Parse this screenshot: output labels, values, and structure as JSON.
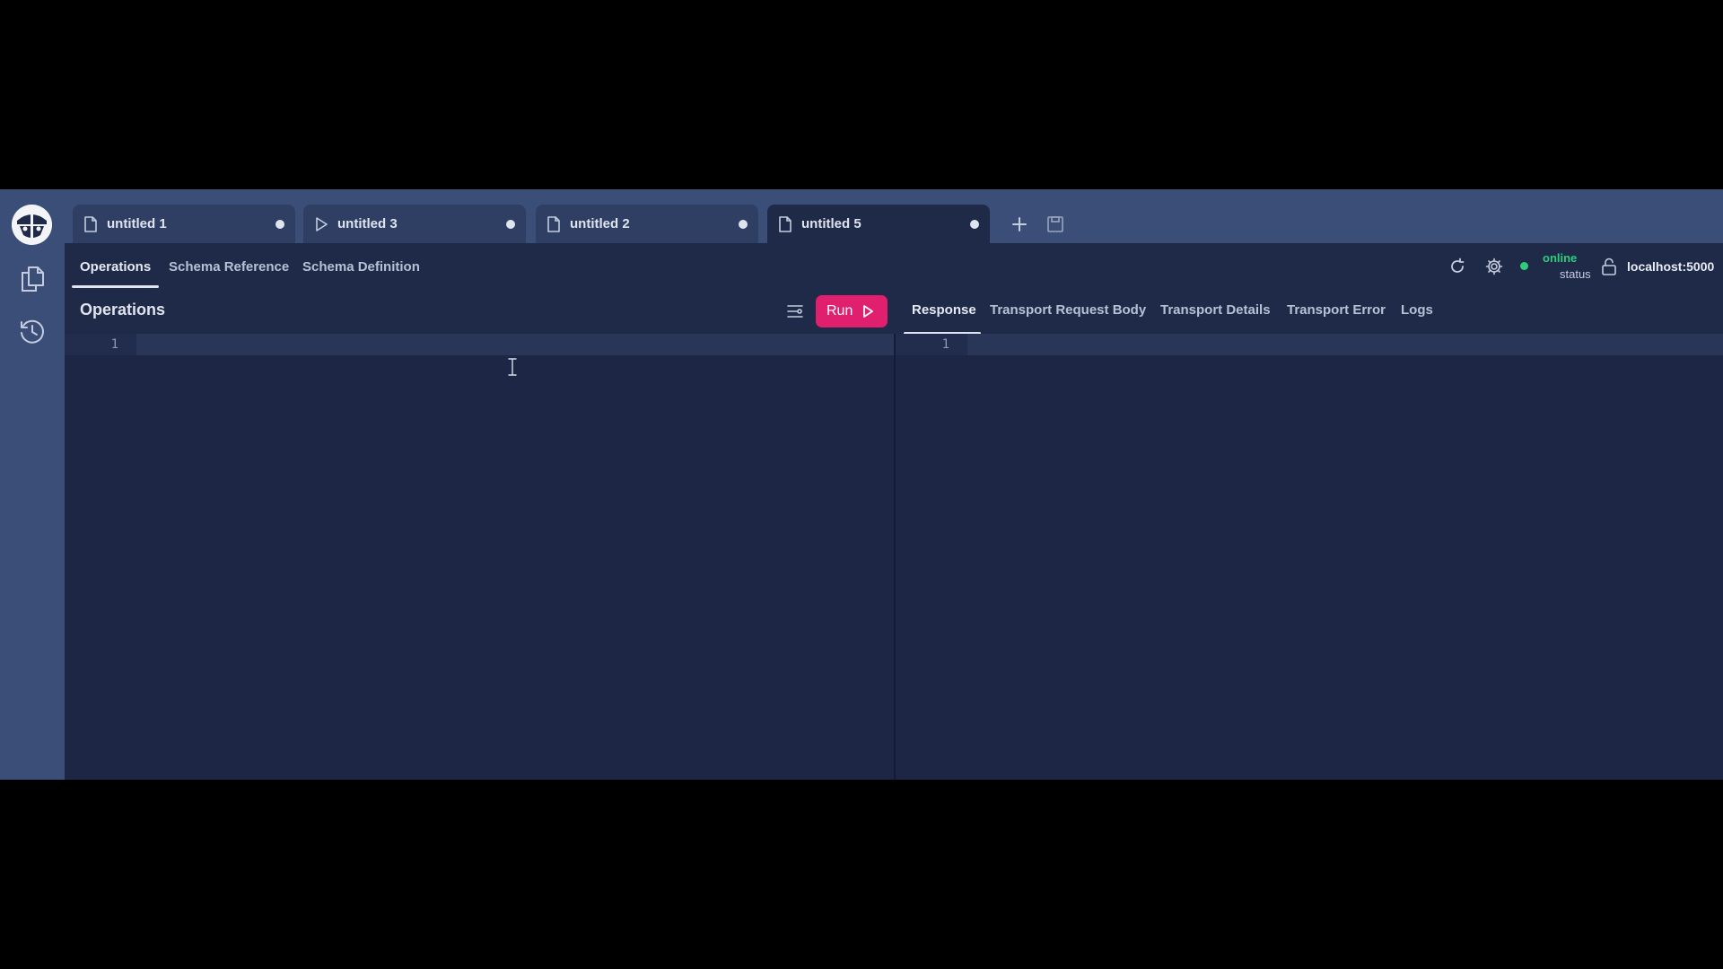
{
  "tabs": [
    {
      "label": "untitled 1",
      "icon": "file-icon",
      "unsaved": true,
      "active": false
    },
    {
      "label": "untitled 3",
      "icon": "play-icon",
      "unsaved": true,
      "active": false
    },
    {
      "label": "untitled 2",
      "icon": "file-icon",
      "unsaved": true,
      "active": false
    },
    {
      "label": "untitled 5",
      "icon": "file-icon",
      "unsaved": true,
      "active": true
    }
  ],
  "tabbar_actions": {
    "add_icon": "plus-icon",
    "save_icon": "save-icon"
  },
  "sidebar": {
    "logo": "altair-logo",
    "items": [
      {
        "icon": "copy-icon"
      },
      {
        "icon": "history-icon"
      }
    ]
  },
  "subnav": {
    "tabs": [
      {
        "label": "Operations",
        "active": true
      },
      {
        "label": "Schema Reference",
        "active": false
      },
      {
        "label": "Schema Definition",
        "active": false
      }
    ]
  },
  "header_right": {
    "reload_icon": "refresh-icon",
    "settings_icon": "gear-icon",
    "status": {
      "value": "online",
      "label": "status",
      "color": "#2ecf7c"
    },
    "lock_icon": "lock-icon",
    "host": "localhost:5000"
  },
  "operations": {
    "title": "Operations",
    "prettify_icon": "prettify-icon",
    "run_label": "Run",
    "run_color": "#e01f6f",
    "line_numbers": [
      "1"
    ]
  },
  "response": {
    "tabs": [
      {
        "label": "Response",
        "active": true
      },
      {
        "label": "Transport Request Body",
        "active": false
      },
      {
        "label": "Transport Details",
        "active": false
      },
      {
        "label": "Transport Error",
        "active": false
      },
      {
        "label": "Logs",
        "active": false
      }
    ],
    "line_numbers": [
      "1"
    ]
  }
}
